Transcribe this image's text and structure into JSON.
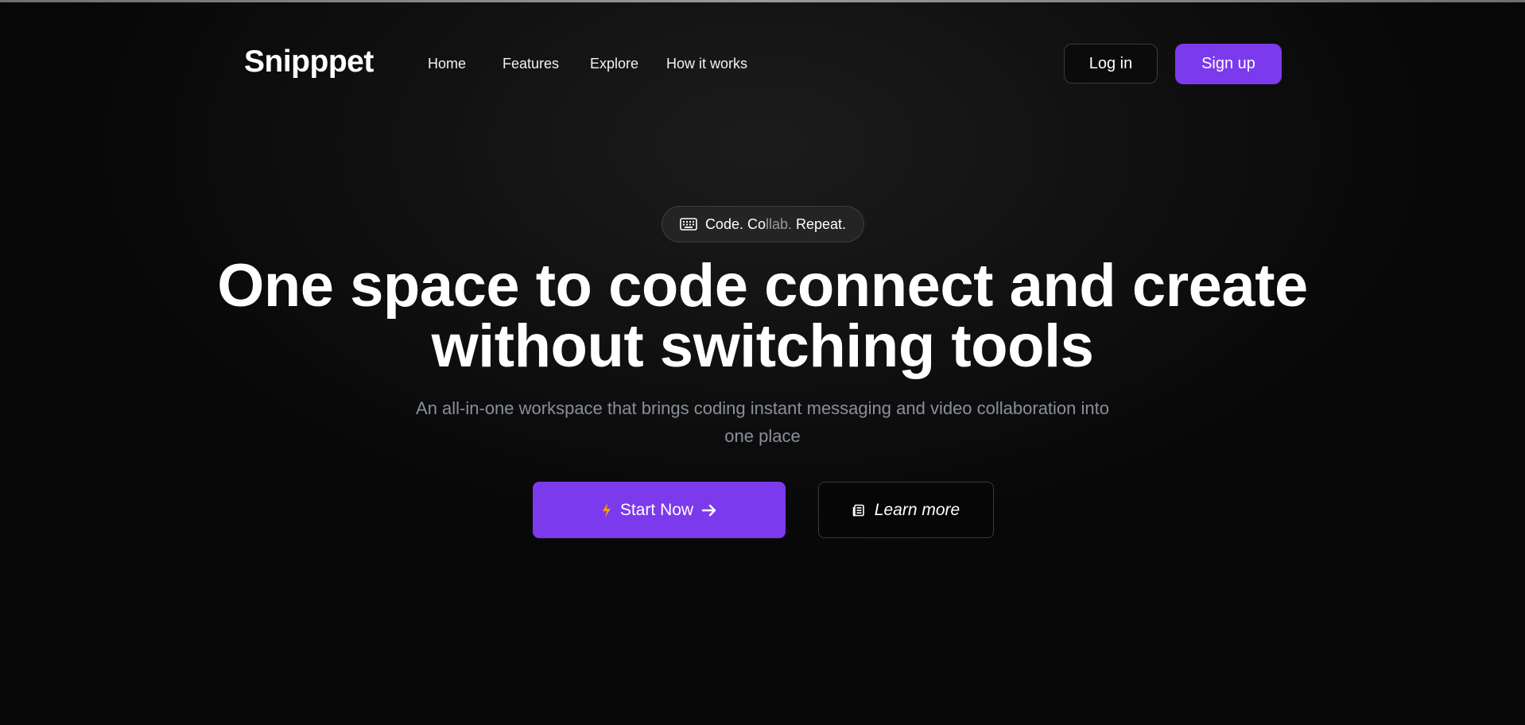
{
  "nav": {
    "logo": "Snipppet",
    "links": [
      {
        "label": "Home"
      },
      {
        "label": "Features"
      },
      {
        "label": "Explore"
      },
      {
        "label": "How it works"
      }
    ],
    "login_label": "Log in",
    "signup_label": "Sign up"
  },
  "hero": {
    "badge": {
      "icon": "keyboard-icon",
      "text_main": "Code. Co",
      "text_dim": "llab.",
      "text_end": " Repeat."
    },
    "headline_line1": "One space to code connect and create",
    "headline_line2": "without switching tools",
    "subtitle_line1": "An all-in-one workspace that brings coding instant messaging and video collaboration into",
    "subtitle_line2": "one place",
    "start_label": "Start Now",
    "start_icons": [
      "lightning-icon",
      "arrow-right-icon"
    ],
    "learn_label": "Learn more",
    "learn_icon": "document-icon"
  },
  "colors": {
    "accent": "#7c3aed",
    "background": "#070707",
    "subtitle_text": "#8a8f9c",
    "lightning": "#f59e0b"
  }
}
